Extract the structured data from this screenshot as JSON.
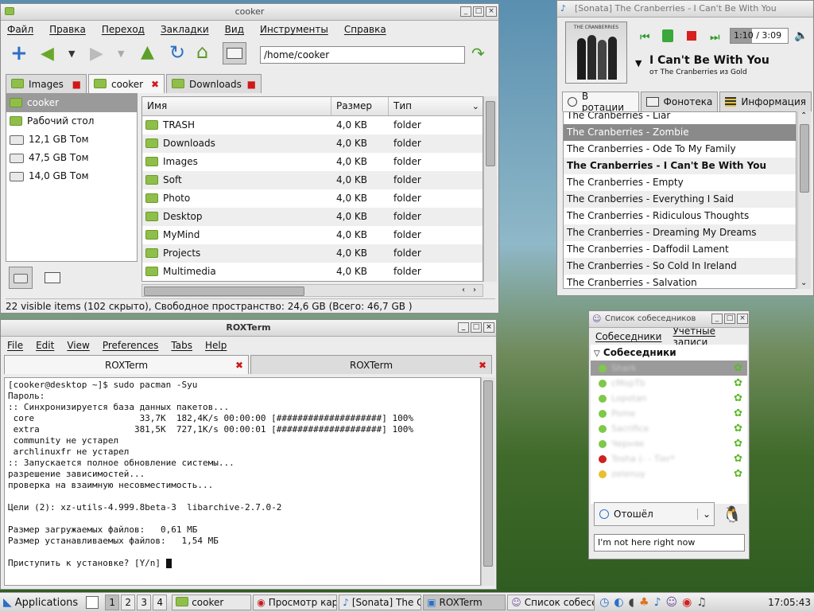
{
  "filemanager": {
    "title": "cooker",
    "menu": [
      "Файл",
      "Правка",
      "Переход",
      "Закладки",
      "Вид",
      "Инструменты",
      "Справка"
    ],
    "path": "/home/cooker",
    "tabs": [
      "Images",
      "cooker",
      "Downloads"
    ],
    "places": [
      "cooker",
      "Рабочий стол",
      "12,1 GB Том",
      "47,5 GB Том",
      "14,0 GB Том"
    ],
    "columns": [
      "Имя",
      "Размер",
      "Тип"
    ],
    "files": [
      {
        "name": "TRASH",
        "size": "4,0 KB",
        "type": "folder"
      },
      {
        "name": "Downloads",
        "size": "4,0 KB",
        "type": "folder"
      },
      {
        "name": "Images",
        "size": "4,0 KB",
        "type": "folder"
      },
      {
        "name": "Soft",
        "size": "4,0 KB",
        "type": "folder"
      },
      {
        "name": "Photo",
        "size": "4,0 KB",
        "type": "folder"
      },
      {
        "name": "Desktop",
        "size": "4,0 KB",
        "type": "folder"
      },
      {
        "name": "MyMind",
        "size": "4,0 KB",
        "type": "folder"
      },
      {
        "name": "Projects",
        "size": "4,0 KB",
        "type": "folder"
      },
      {
        "name": "Multimedia",
        "size": "4,0 KB",
        "type": "folder"
      }
    ],
    "status": "22 visible items (102 скрыто), Свободное пространство: 24,6 GB (Всего: 46,7 GB )"
  },
  "player": {
    "title": "[Sonata] The Cranberries - I Can't Be With You",
    "time": "1:10 / 3:09",
    "song": "I Can't Be With You",
    "subtitle": "от The Cranberries из Gold",
    "cover_text": "THE CRANBERRIES",
    "tabs": [
      "В ротации",
      "Фонотека",
      "Информация"
    ],
    "playlist": [
      "The Cranberries - Liar",
      "The Cranberries - Zombie",
      "The Cranberries - Ode To My Family",
      "The Cranberries - I Can't Be With You",
      "The Cranberries - Empty",
      "The Cranberries - Everything I Said",
      "The Cranberries - Ridiculous Thoughts",
      "The Cranberries - Dreaming My Dreams",
      "The Cranberries - Daffodil Lament",
      "The Cranberries - So Cold In Ireland",
      "The Cranberries - Salvation"
    ],
    "selected_index": 1,
    "playing_index": 3
  },
  "terminal": {
    "title": "ROXTerm",
    "menu": [
      "File",
      "Edit",
      "View",
      "Preferences",
      "Tabs",
      "Help"
    ],
    "tabs": [
      "ROXTerm",
      "ROXTerm"
    ],
    "lines": [
      "[cooker@desktop ~]$ sudo pacman -Syu",
      "Пароль:",
      ":: Синхронизируется база данных пакетов...",
      " core                    33,7K  182,4K/s 00:00:00 [####################] 100%",
      " extra                  381,5K  727,1K/s 00:00:01 [####################] 100%",
      " community не устарел",
      " archlinuxfr не устарел",
      ":: Запускается полное обновление системы...",
      "разрешение зависимостей...",
      "проверка на взаимную несовместимость...",
      "",
      "Цели (2): xz-utils-4.999.8beta-3  libarchive-2.7.0-2",
      "",
      "Размер загружаемых файлов:   0,61 МБ",
      "Размер устанавливаемых файлов:   1,54 МБ",
      "",
      "Приступить к установке? [Y/n] "
    ]
  },
  "im": {
    "title": "Список собеседников",
    "menu": [
      "Собеседники",
      "Учётные записи"
    ],
    "group": "Собеседники",
    "contacts": [
      "Shark",
      "cMopTb",
      "Lopotan",
      "Pome",
      "Sacrifice",
      "Черняк",
      "Tosha (-  - Tier*",
      "zelenuy"
    ],
    "status_select": "Отошёл",
    "status_message": "I'm not here right now"
  },
  "taskbar": {
    "applications": "Applications",
    "workspaces": [
      "1",
      "2",
      "3",
      "4"
    ],
    "tasks": [
      "cooker",
      "Просмотр кар",
      "[Sonata] The C",
      "ROXTerm",
      "Список собесе"
    ],
    "clock": "17:05:43"
  }
}
